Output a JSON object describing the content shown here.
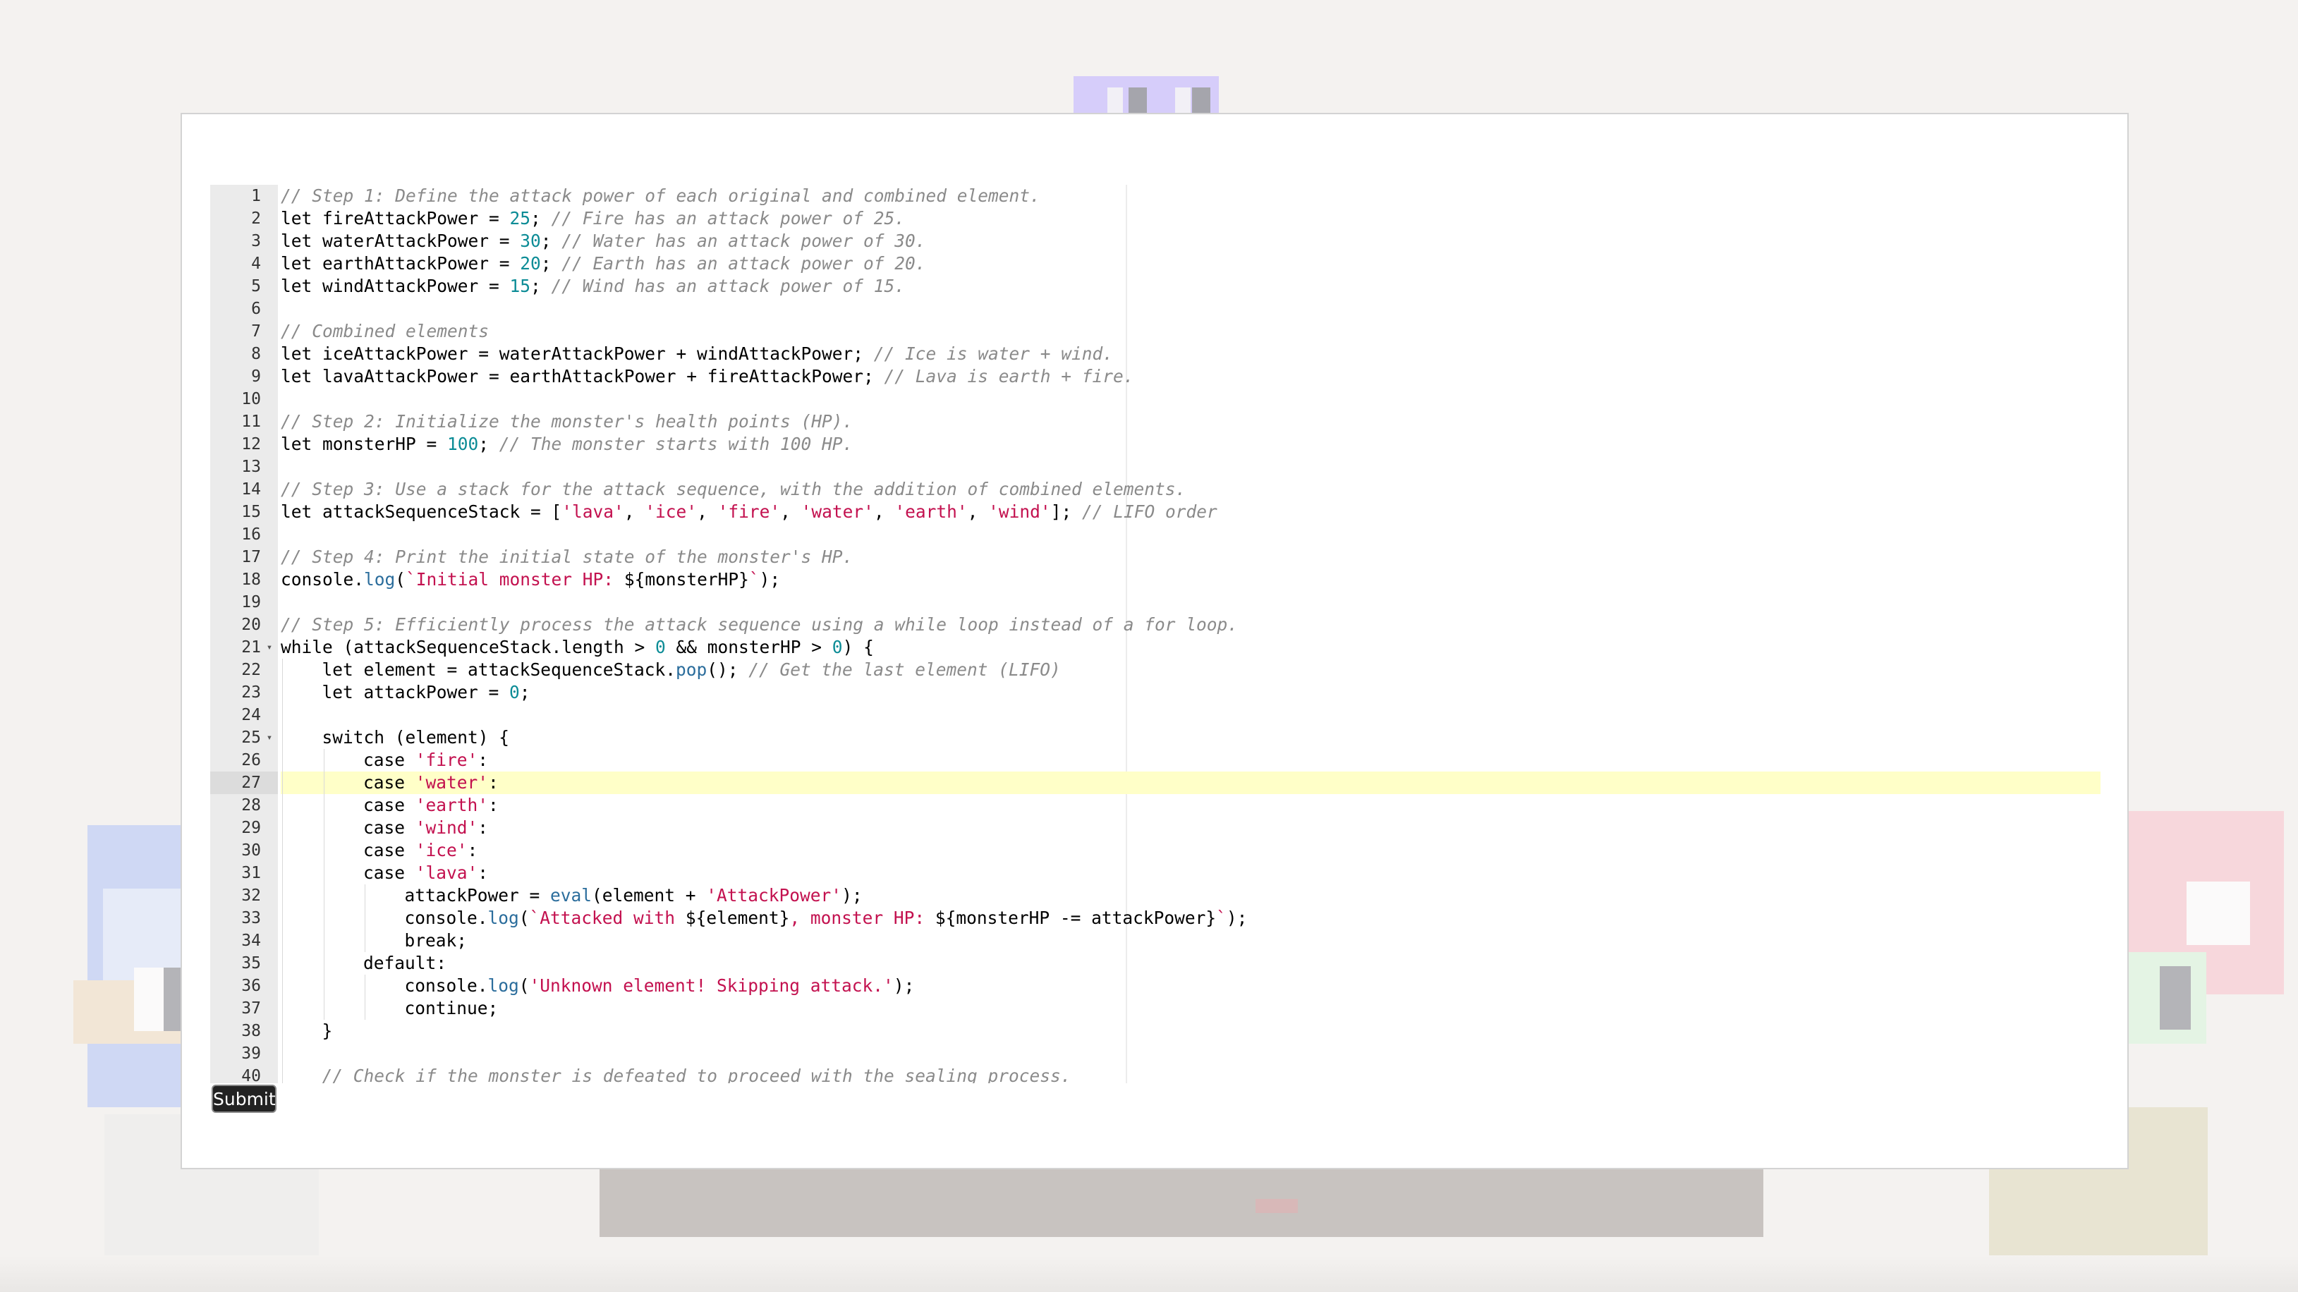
{
  "editor": {
    "active_line": 27,
    "lines": [
      {
        "n": "1",
        "indent": 0,
        "tokens": [
          [
            "c",
            "// Step 1: Define the attack power of each original and combined element."
          ]
        ]
      },
      {
        "n": "2",
        "indent": 0,
        "tokens": [
          [
            "t",
            "let fireAttackPower = "
          ],
          [
            "n",
            "25"
          ],
          [
            "t",
            "; "
          ],
          [
            "c",
            "// Fire has an attack power of 25."
          ]
        ]
      },
      {
        "n": "3",
        "indent": 0,
        "tokens": [
          [
            "t",
            "let waterAttackPower = "
          ],
          [
            "n",
            "30"
          ],
          [
            "t",
            "; "
          ],
          [
            "c",
            "// Water has an attack power of 30."
          ]
        ]
      },
      {
        "n": "4",
        "indent": 0,
        "tokens": [
          [
            "t",
            "let earthAttackPower = "
          ],
          [
            "n",
            "20"
          ],
          [
            "t",
            "; "
          ],
          [
            "c",
            "// Earth has an attack power of 20."
          ]
        ]
      },
      {
        "n": "5",
        "indent": 0,
        "tokens": [
          [
            "t",
            "let windAttackPower = "
          ],
          [
            "n",
            "15"
          ],
          [
            "t",
            "; "
          ],
          [
            "c",
            "// Wind has an attack power of 15."
          ]
        ]
      },
      {
        "n": "6",
        "indent": 0,
        "tokens": []
      },
      {
        "n": "7",
        "indent": 0,
        "tokens": [
          [
            "c",
            "// Combined elements"
          ]
        ]
      },
      {
        "n": "8",
        "indent": 0,
        "tokens": [
          [
            "t",
            "let iceAttackPower = waterAttackPower + windAttackPower; "
          ],
          [
            "c",
            "// Ice is water + wind."
          ]
        ]
      },
      {
        "n": "9",
        "indent": 0,
        "tokens": [
          [
            "t",
            "let lavaAttackPower = earthAttackPower + fireAttackPower; "
          ],
          [
            "c",
            "// Lava is earth + fire."
          ]
        ]
      },
      {
        "n": "10",
        "indent": 0,
        "tokens": []
      },
      {
        "n": "11",
        "indent": 0,
        "tokens": [
          [
            "c",
            "// Step 2: Initialize the monster's health points (HP)."
          ]
        ]
      },
      {
        "n": "12",
        "indent": 0,
        "tokens": [
          [
            "t",
            "let monsterHP = "
          ],
          [
            "n",
            "100"
          ],
          [
            "t",
            "; "
          ],
          [
            "c",
            "// The monster starts with 100 HP."
          ]
        ]
      },
      {
        "n": "13",
        "indent": 0,
        "tokens": []
      },
      {
        "n": "14",
        "indent": 0,
        "tokens": [
          [
            "c",
            "// Step 3: Use a stack for the attack sequence, with the addition of combined elements."
          ]
        ]
      },
      {
        "n": "15",
        "indent": 0,
        "tokens": [
          [
            "t",
            "let attackSequenceStack = ["
          ],
          [
            "s",
            "'lava'"
          ],
          [
            "t",
            ", "
          ],
          [
            "s",
            "'ice'"
          ],
          [
            "t",
            ", "
          ],
          [
            "s",
            "'fire'"
          ],
          [
            "t",
            ", "
          ],
          [
            "s",
            "'water'"
          ],
          [
            "t",
            ", "
          ],
          [
            "s",
            "'earth'"
          ],
          [
            "t",
            ", "
          ],
          [
            "s",
            "'wind'"
          ],
          [
            "t",
            "]; "
          ],
          [
            "c",
            "// LIFO order"
          ]
        ]
      },
      {
        "n": "16",
        "indent": 0,
        "tokens": []
      },
      {
        "n": "17",
        "indent": 0,
        "tokens": [
          [
            "c",
            "// Step 4: Print the initial state of the monster's HP."
          ]
        ]
      },
      {
        "n": "18",
        "indent": 0,
        "tokens": [
          [
            "t",
            "console."
          ],
          [
            "f",
            "log"
          ],
          [
            "t",
            "("
          ],
          [
            "s",
            "`Initial monster HP: "
          ],
          [
            "t",
            "${monsterHP}"
          ],
          [
            "s",
            "`"
          ],
          [
            "t",
            ");"
          ]
        ]
      },
      {
        "n": "19",
        "indent": 0,
        "tokens": []
      },
      {
        "n": "20",
        "indent": 0,
        "tokens": [
          [
            "c",
            "// Step 5: Efficiently process the attack sequence using a while loop instead of a for loop."
          ]
        ]
      },
      {
        "n": "21",
        "indent": 0,
        "fold": true,
        "tokens": [
          [
            "t",
            "while (attackSequenceStack.length > "
          ],
          [
            "n",
            "0"
          ],
          [
            "t",
            " && monsterHP > "
          ],
          [
            "n",
            "0"
          ],
          [
            "t",
            ") {"
          ]
        ]
      },
      {
        "n": "22",
        "indent": 1,
        "tokens": [
          [
            "t",
            "let element = attackSequenceStack."
          ],
          [
            "f",
            "pop"
          ],
          [
            "t",
            "(); "
          ],
          [
            "c",
            "// Get the last element (LIFO)"
          ]
        ]
      },
      {
        "n": "23",
        "indent": 1,
        "tokens": [
          [
            "t",
            "let attackPower = "
          ],
          [
            "n",
            "0"
          ],
          [
            "t",
            ";"
          ]
        ]
      },
      {
        "n": "24",
        "indent": 1,
        "tokens": []
      },
      {
        "n": "25",
        "indent": 1,
        "fold": true,
        "tokens": [
          [
            "t",
            "switch (element) {"
          ]
        ]
      },
      {
        "n": "26",
        "indent": 2,
        "tokens": [
          [
            "t",
            "case "
          ],
          [
            "s",
            "'fire'"
          ],
          [
            "t",
            ":"
          ]
        ]
      },
      {
        "n": "27",
        "indent": 2,
        "tokens": [
          [
            "t",
            "case "
          ],
          [
            "s",
            "'water'"
          ],
          [
            "t",
            ":"
          ]
        ]
      },
      {
        "n": "28",
        "indent": 2,
        "tokens": [
          [
            "t",
            "case "
          ],
          [
            "s",
            "'earth'"
          ],
          [
            "t",
            ":"
          ]
        ]
      },
      {
        "n": "29",
        "indent": 2,
        "tokens": [
          [
            "t",
            "case "
          ],
          [
            "s",
            "'wind'"
          ],
          [
            "t",
            ":"
          ]
        ]
      },
      {
        "n": "30",
        "indent": 2,
        "tokens": [
          [
            "t",
            "case "
          ],
          [
            "s",
            "'ice'"
          ],
          [
            "t",
            ":"
          ]
        ]
      },
      {
        "n": "31",
        "indent": 2,
        "tokens": [
          [
            "t",
            "case "
          ],
          [
            "s",
            "'lava'"
          ],
          [
            "t",
            ":"
          ]
        ]
      },
      {
        "n": "32",
        "indent": 3,
        "tokens": [
          [
            "t",
            "attackPower = "
          ],
          [
            "f",
            "eval"
          ],
          [
            "t",
            "(element + "
          ],
          [
            "s",
            "'AttackPower'"
          ],
          [
            "t",
            ");"
          ]
        ]
      },
      {
        "n": "33",
        "indent": 3,
        "tokens": [
          [
            "t",
            "console."
          ],
          [
            "f",
            "log"
          ],
          [
            "t",
            "("
          ],
          [
            "s",
            "`Attacked with "
          ],
          [
            "t",
            "${element}"
          ],
          [
            "s",
            ", monster HP: "
          ],
          [
            "t",
            "${monsterHP -= attackPower}"
          ],
          [
            "s",
            "`"
          ],
          [
            "t",
            ");"
          ]
        ]
      },
      {
        "n": "34",
        "indent": 3,
        "tokens": [
          [
            "t",
            "break;"
          ]
        ]
      },
      {
        "n": "35",
        "indent": 2,
        "tokens": [
          [
            "t",
            "default:"
          ]
        ]
      },
      {
        "n": "36",
        "indent": 3,
        "tokens": [
          [
            "t",
            "console."
          ],
          [
            "f",
            "log"
          ],
          [
            "t",
            "("
          ],
          [
            "s",
            "'Unknown element! Skipping attack.'"
          ],
          [
            "t",
            ");"
          ]
        ]
      },
      {
        "n": "37",
        "indent": 3,
        "tokens": [
          [
            "t",
            "continue;"
          ]
        ]
      },
      {
        "n": "38",
        "indent": 1,
        "tokens": [
          [
            "t",
            "}"
          ]
        ]
      },
      {
        "n": "39",
        "indent": 1,
        "tokens": []
      },
      {
        "n": "40",
        "indent": 1,
        "tokens": [
          [
            "c",
            "// Check if the monster is defeated to proceed with the sealing process."
          ]
        ]
      }
    ]
  },
  "submit": {
    "label": "Submit"
  },
  "colors": {
    "comment": "#8a8a8a",
    "number": "#0c8c96",
    "string": "#c3114f",
    "function": "#2b6d9c",
    "active_line": "#ffffc8",
    "button_bg": "#222222"
  }
}
